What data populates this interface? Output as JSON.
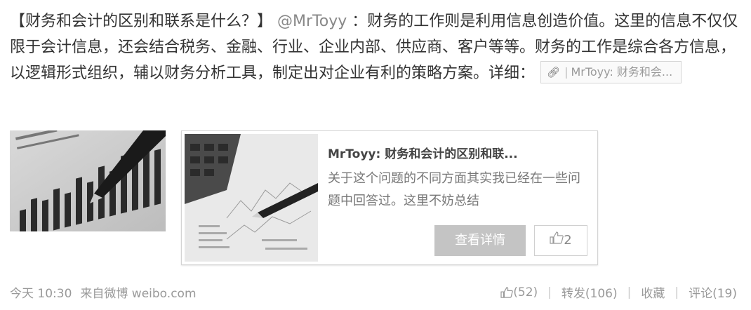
{
  "post": {
    "title": "【财务和会计的区别和联系是什么？】",
    "mention": "@MrToyy",
    "body": "：财务的工作则是利用信息创造价值。这里的信息不仅仅限于会计信息，还会结合税务、金融、行业、企业内部、供应商、客户等等。财务的工作是综合各方信息，以逻辑形式组织，辅以财务分析工具，制定出对企业有利的策略方案。详细：",
    "link_chip": "MrToyy: 财务和会..."
  },
  "card": {
    "title": "MrToyy: 财务和会计的区别和联...",
    "description": "关于这个问题的不同方面其实我已经在一些问题中回答过。这里不妨总结",
    "view_button": "查看详情",
    "like_count": "2"
  },
  "footer": {
    "time": "今天 10:30",
    "source": "来自微博 weibo.com",
    "likes": "(52)",
    "repost": "转发(106)",
    "favorite": "收藏",
    "comment": "评论(19)"
  },
  "icons": {
    "link": "link-icon",
    "thumb": "thumbs-up-icon"
  }
}
